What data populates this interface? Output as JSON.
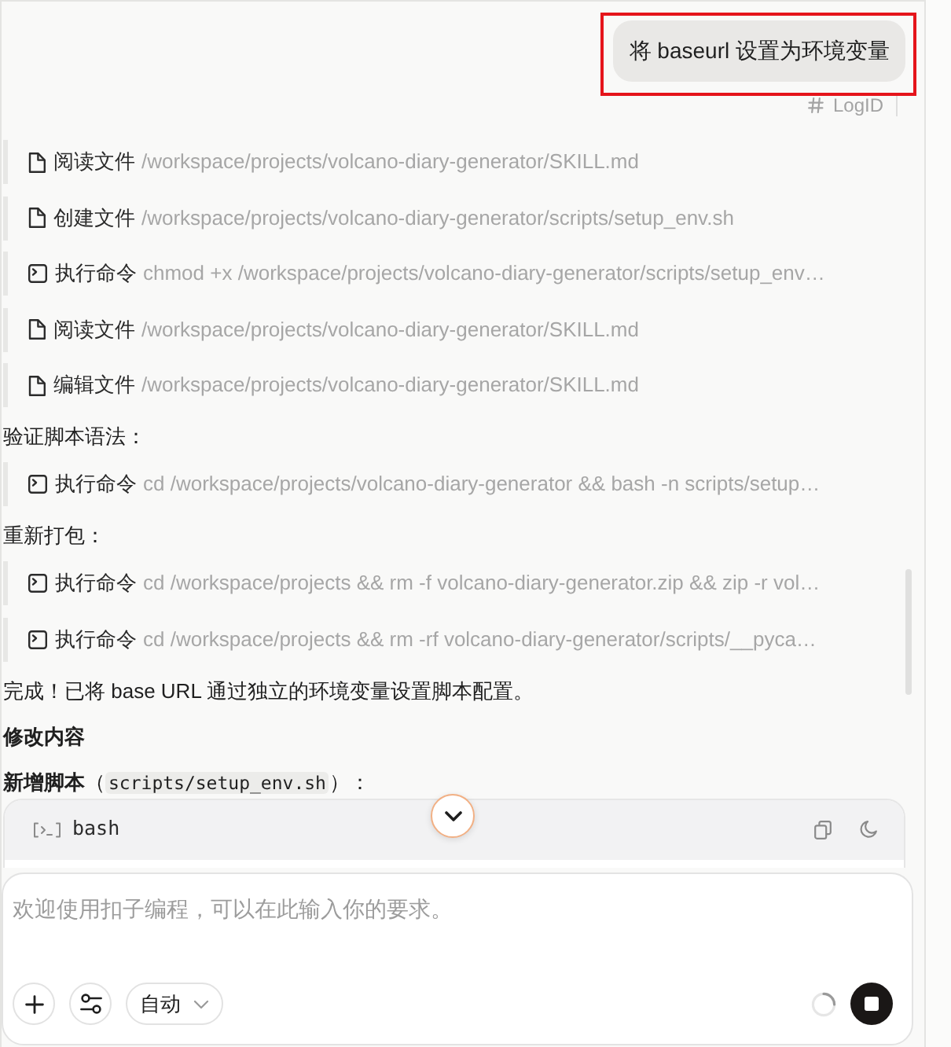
{
  "user_message": {
    "text": "将 baseurl 设置为环境变量",
    "highlighted": true
  },
  "log_id": {
    "label": "LogID"
  },
  "transcript": [
    {
      "kind": "file_op",
      "action": "阅读文件",
      "detail": "/workspace/projects/volcano-diary-generator/SKILL.md"
    },
    {
      "kind": "file_op",
      "action": "创建文件",
      "detail": "/workspace/projects/volcano-diary-generator/scripts/setup_env.sh"
    },
    {
      "kind": "command",
      "action": "执行命令",
      "detail": "chmod +x /workspace/projects/volcano-diary-generator/scripts/setup_env…"
    },
    {
      "kind": "file_op",
      "action": "阅读文件",
      "detail": "/workspace/projects/volcano-diary-generator/SKILL.md"
    },
    {
      "kind": "file_op",
      "action": "编辑文件",
      "detail": "/workspace/projects/volcano-diary-generator/SKILL.md"
    },
    {
      "kind": "text",
      "text": "验证脚本语法："
    },
    {
      "kind": "command",
      "action": "执行命令",
      "detail": "cd /workspace/projects/volcano-diary-generator && bash -n scripts/setup…"
    },
    {
      "kind": "text",
      "text": "重新打包："
    },
    {
      "kind": "command",
      "action": "执行命令",
      "detail": "cd /workspace/projects && rm -f volcano-diary-generator.zip && zip -r vol…"
    },
    {
      "kind": "command",
      "action": "执行命令",
      "detail": "cd /workspace/projects && rm -rf volcano-diary-generator/scripts/__pyca…"
    },
    {
      "kind": "text",
      "text": "完成！已将 base URL 通过独立的环境变量设置脚本配置。"
    },
    {
      "kind": "heading",
      "text": "修改内容"
    },
    {
      "kind": "code_ref",
      "text_before": "**新增脚本**（",
      "code": "scripts/setup_env.sh",
      "text_after": "）："
    },
    {
      "kind": "code_block",
      "language": "bash"
    }
  ],
  "composer": {
    "placeholder": "欢迎使用扣子编程，可以在此输入你的要求。",
    "mode": "自动",
    "running": true
  }
}
